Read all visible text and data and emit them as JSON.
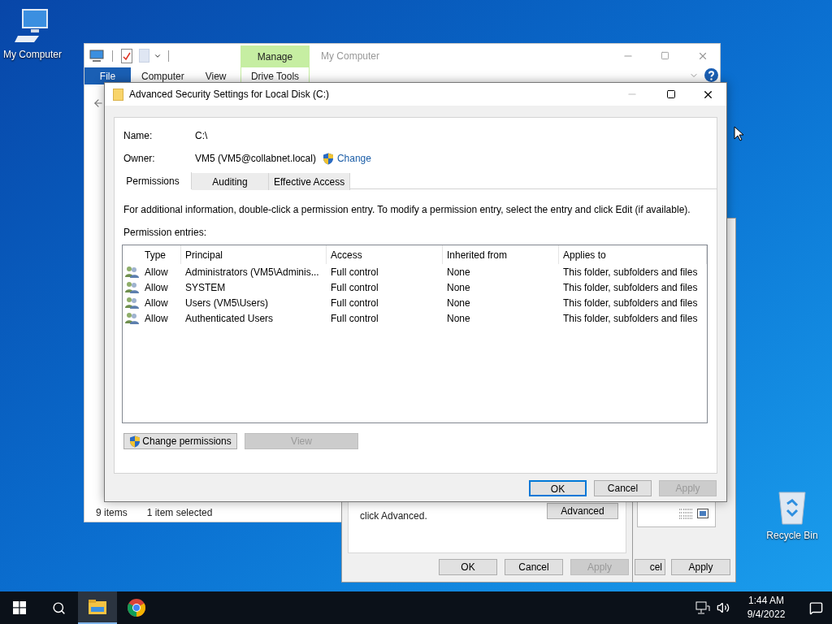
{
  "desktop_icons": [
    {
      "kind": "computer",
      "label": "My Computer"
    },
    {
      "kind": "recycle",
      "label": "Recycle Bin"
    }
  ],
  "explorer": {
    "contextual_tab": "Manage",
    "title": "My Computer",
    "ribbon_tabs": [
      {
        "kind": "file",
        "label": "File"
      },
      {
        "kind": "tab",
        "label": "Computer"
      },
      {
        "kind": "tab",
        "label": "View"
      },
      {
        "kind": "contextual",
        "label": "Drive Tools"
      }
    ],
    "status": [
      "9 items",
      "1 item selected"
    ]
  },
  "properties_back": {
    "buttons": [
      {
        "label": "cel",
        "disabled": false
      },
      {
        "label": "Apply",
        "disabled": false
      }
    ]
  },
  "properties_front": {
    "note": "click Advanced.",
    "advanced_button": "Advanced",
    "buttons": [
      {
        "label": "OK",
        "disabled": false
      },
      {
        "label": "Cancel",
        "disabled": false
      },
      {
        "label": "Apply",
        "disabled": true
      }
    ]
  },
  "dialog": {
    "title": "Advanced Security Settings for Local Disk (C:)",
    "name_label": "Name:",
    "name_value": "C:\\",
    "owner_label": "Owner:",
    "owner_value": "VM5 (VM5@collabnet.local)",
    "change_link": "Change",
    "tabs": [
      {
        "label": "Permissions",
        "selected": true
      },
      {
        "label": "Auditing",
        "selected": false
      },
      {
        "label": "Effective Access",
        "selected": false
      }
    ],
    "info": "For additional information, double-click a permission entry. To modify a permission entry, select the entry and click Edit (if available).",
    "entries_label": "Permission entries:",
    "columns": [
      "Type",
      "Principal",
      "Access",
      "Inherited from",
      "Applies to"
    ],
    "rows": [
      {
        "type": "Allow",
        "principal": "Administrators (VM5\\Adminis...",
        "access": "Full control",
        "inherited": "None",
        "applies": "This folder, subfolders and files"
      },
      {
        "type": "Allow",
        "principal": "SYSTEM",
        "access": "Full control",
        "inherited": "None",
        "applies": "This folder, subfolders and files"
      },
      {
        "type": "Allow",
        "principal": "Users (VM5\\Users)",
        "access": "Full control",
        "inherited": "None",
        "applies": "This folder, subfolders and files"
      },
      {
        "type": "Allow",
        "principal": "Authenticated Users",
        "access": "Full control",
        "inherited": "None",
        "applies": "This folder, subfolders and files"
      }
    ],
    "actions": [
      {
        "label": "Change permissions",
        "shield": true,
        "disabled": false
      },
      {
        "label": "View",
        "shield": false,
        "disabled": true
      }
    ],
    "buttons": [
      {
        "label": "OK",
        "default": true,
        "disabled": false
      },
      {
        "label": "Cancel",
        "default": false,
        "disabled": false
      },
      {
        "label": "Apply",
        "default": false,
        "disabled": true
      }
    ]
  },
  "taskbar": {
    "apps": [
      {
        "kind": "explorer",
        "active": true
      },
      {
        "kind": "chrome",
        "active": false
      }
    ],
    "time": "1:44 AM",
    "date": "9/4/2022"
  }
}
